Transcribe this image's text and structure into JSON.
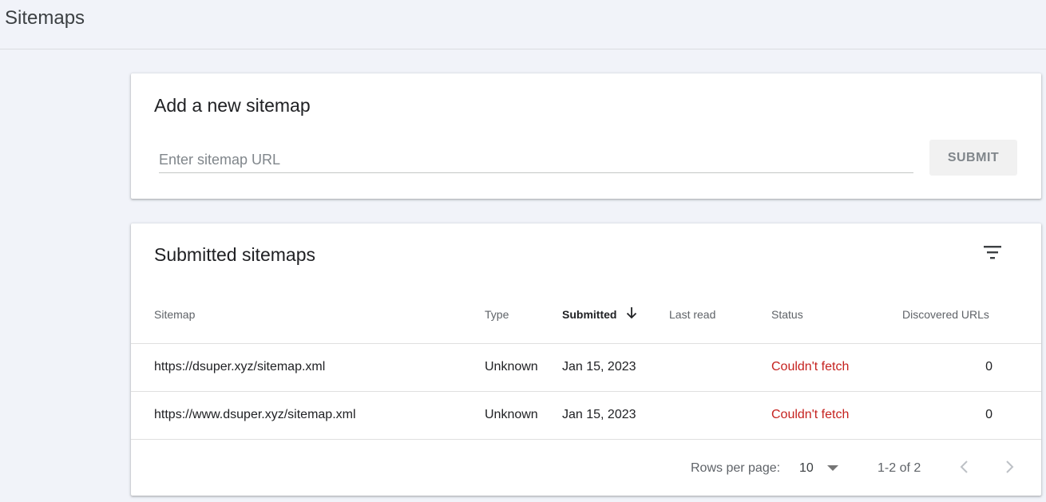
{
  "header": {
    "title": "Sitemaps"
  },
  "add_card": {
    "title": "Add a new sitemap",
    "input_placeholder": "Enter sitemap URL",
    "input_value": "",
    "submit_label": "SUBMIT"
  },
  "list_card": {
    "title": "Submitted sitemaps",
    "filter_icon": "filter-list-icon",
    "columns": {
      "sitemap": "Sitemap",
      "type": "Type",
      "submitted": "Submitted",
      "last_read": "Last read",
      "status": "Status",
      "discovered": "Discovered URLs"
    },
    "sort_icon": "arrow-down-icon",
    "rows": [
      {
        "sitemap": "https://dsuper.xyz/sitemap.xml",
        "type": "Unknown",
        "submitted": "Jan 15, 2023",
        "last_read": "",
        "status": "Couldn't fetch",
        "discovered": "0"
      },
      {
        "sitemap": "https://www.dsuper.xyz/sitemap.xml",
        "type": "Unknown",
        "submitted": "Jan 15, 2023",
        "last_read": "",
        "status": "Couldn't fetch",
        "discovered": "0"
      }
    ],
    "footer": {
      "rows_per_page_label": "Rows per page:",
      "rows_per_page_value": "10",
      "range_label": "1-2 of 2"
    }
  },
  "colors": {
    "status_error": "#c5221f",
    "background": "#f1f3f9"
  }
}
